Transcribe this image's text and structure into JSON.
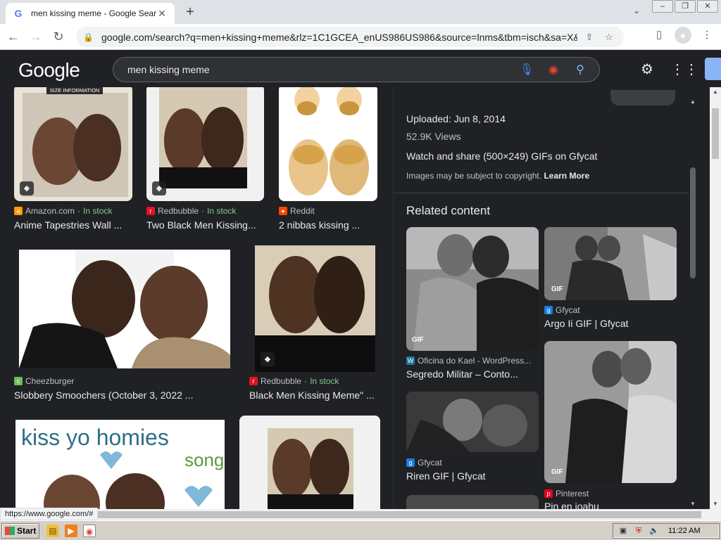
{
  "browser": {
    "tab_title": "men kissing meme - Google Search",
    "url": "google.com/search?q=men+kissing+meme&rlz=1C1GCEA_enUS986US986&source=lnms&tbm=isch&sa=X&ved...",
    "status_url": "https://www.google.com/#"
  },
  "google": {
    "logo": "Google",
    "query": "men kissing meme"
  },
  "results": [
    {
      "source": "Amazon.com",
      "stock": "In stock",
      "caption": "Anime Tapestries Wall ...",
      "size_label": "SIZE INFORMATION",
      "source_color": "#ff9900"
    },
    {
      "source": "Redbubble",
      "stock": "In stock",
      "caption": "Two Black Men Kissing...",
      "source_color": "#e41321"
    },
    {
      "source": "Reddit",
      "stock": "",
      "caption": "2 nibbas kissing ...",
      "source_color": "#ff4500"
    },
    {
      "source": "Cheezburger",
      "stock": "",
      "caption": "Slobbery Smoochers (October 3, 2022 ...",
      "source_color": "#6bbf59"
    },
    {
      "source": "Redbubble",
      "stock": "In stock",
      "caption": "Black Men Kissing Meme\" ...",
      "source_color": "#e41321"
    },
    {
      "overlay_line1": "kiss yo homies",
      "overlay_line2": "song"
    },
    {}
  ],
  "panel": {
    "uploaded": "Uploaded: Jun 8, 2014",
    "views": "52.9K Views",
    "watch": "Watch and share (500×249) GIFs on Gfycat",
    "copyright": "Images may be subject to copyright.",
    "learn_more": "Learn More",
    "related_title": "Related content",
    "related": [
      {
        "source": "Oficina do Kael - WordPress...",
        "caption": "Segredo Militar – Conto...",
        "badge": "GIF"
      },
      {
        "source": "Gfycat",
        "caption": "Argo Ii GIF | Gfycat",
        "badge": "GIF"
      },
      {
        "source": "Gfycat",
        "caption": "Riren GIF | Gfycat",
        "badge": ""
      },
      {
        "source": "Pinterest",
        "caption": "Pin en joahu",
        "badge": "GIF"
      }
    ]
  },
  "taskbar": {
    "start": "Start",
    "clock": "11:22 AM"
  }
}
